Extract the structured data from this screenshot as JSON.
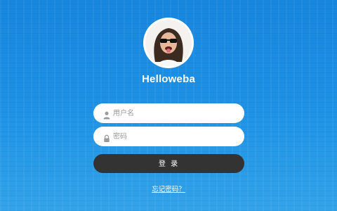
{
  "profile": {
    "username": "Helloweba",
    "avatar_icon": "avatar-sunglasses-person"
  },
  "form": {
    "username_placeholder": "用户名",
    "username_value": "",
    "username_icon": "user-icon",
    "password_placeholder": "密码",
    "password_value": "",
    "password_icon": "lock-icon",
    "login_label": "登 录",
    "forgot_label": "忘记密码？"
  },
  "colors": {
    "background": "#1e92e6",
    "button": "#333333",
    "field": "#ffffff",
    "text_light": "#ffffff",
    "placeholder": "#9a9a9a"
  }
}
